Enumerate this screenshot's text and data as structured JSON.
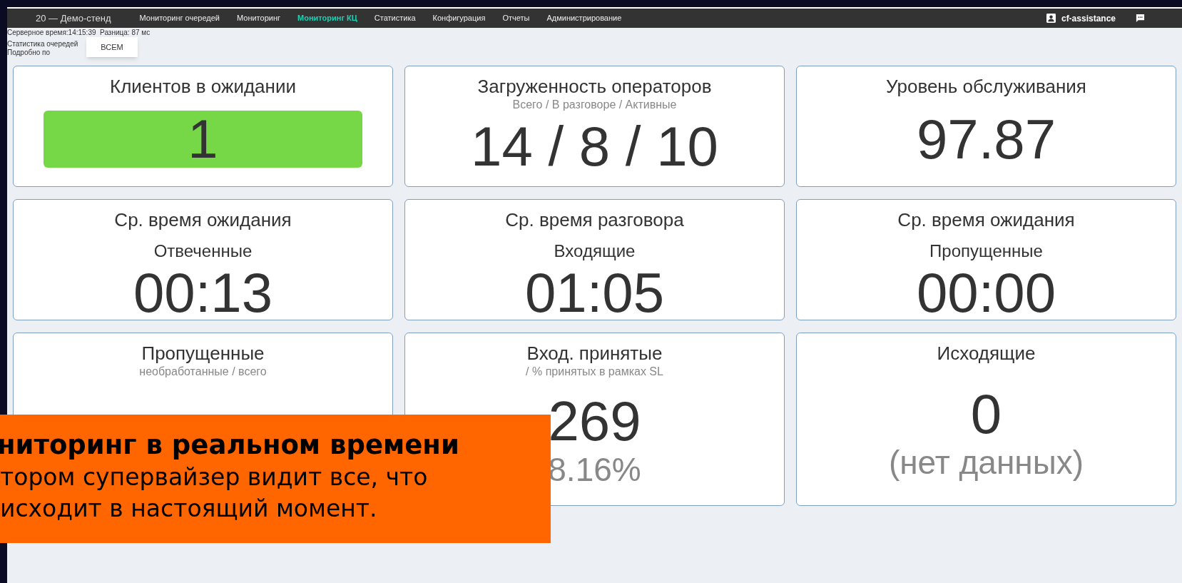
{
  "brand": "20 — Демо-стенд",
  "nav": [
    {
      "label": "Мониторинг очередей",
      "selected": false
    },
    {
      "label": "Мониторинг",
      "selected": false
    },
    {
      "label": "Мониторинг КЦ",
      "selected": true
    },
    {
      "label": "Статистика",
      "selected": false
    },
    {
      "label": "Конфигурация",
      "selected": false
    },
    {
      "label": "Отчеты",
      "selected": false
    },
    {
      "label": "Администрирование",
      "selected": false
    }
  ],
  "user": "cf-assistance",
  "server_time": "Серверное время:14:15:39  Разница: 87 мс",
  "info_lines": [
    "Статистика очередей",
    "Подробно по"
  ],
  "filter_button": "ВСЕМ",
  "cards": [
    {
      "title": "Клиентов в ожидании",
      "value": "1",
      "color": "#76d846"
    },
    {
      "title": "Загруженность операторов",
      "note": "Всего / В разговоре / Активные",
      "value": "14 / 8 / 10"
    },
    {
      "title": "Уровень обслуживания",
      "value": "97.87"
    },
    {
      "title": "Ср. время ожидания",
      "subtitle": "Отвеченные",
      "value": "00:13"
    },
    {
      "title": "Ср. время разговора",
      "subtitle": "Входящие",
      "value": "01:05"
    },
    {
      "title": "Ср. время ожидания",
      "subtitle": "Пропущенные",
      "value": "00:00"
    },
    {
      "title": "Пропущенные",
      "note": "необработанные / всего"
    },
    {
      "title": "Вход. принятые",
      "note": "/ % принятых в рамках SL",
      "value": "269",
      "secondary": "8.16%"
    },
    {
      "title": "Исходящие",
      "value": "0",
      "secondary": "(нет данных)"
    }
  ],
  "overlay": {
    "heading": "ниторинг в реальном времени",
    "lines": [
      "тором супервайзер видит все, что",
      "исходит в настоящий момент."
    ]
  }
}
